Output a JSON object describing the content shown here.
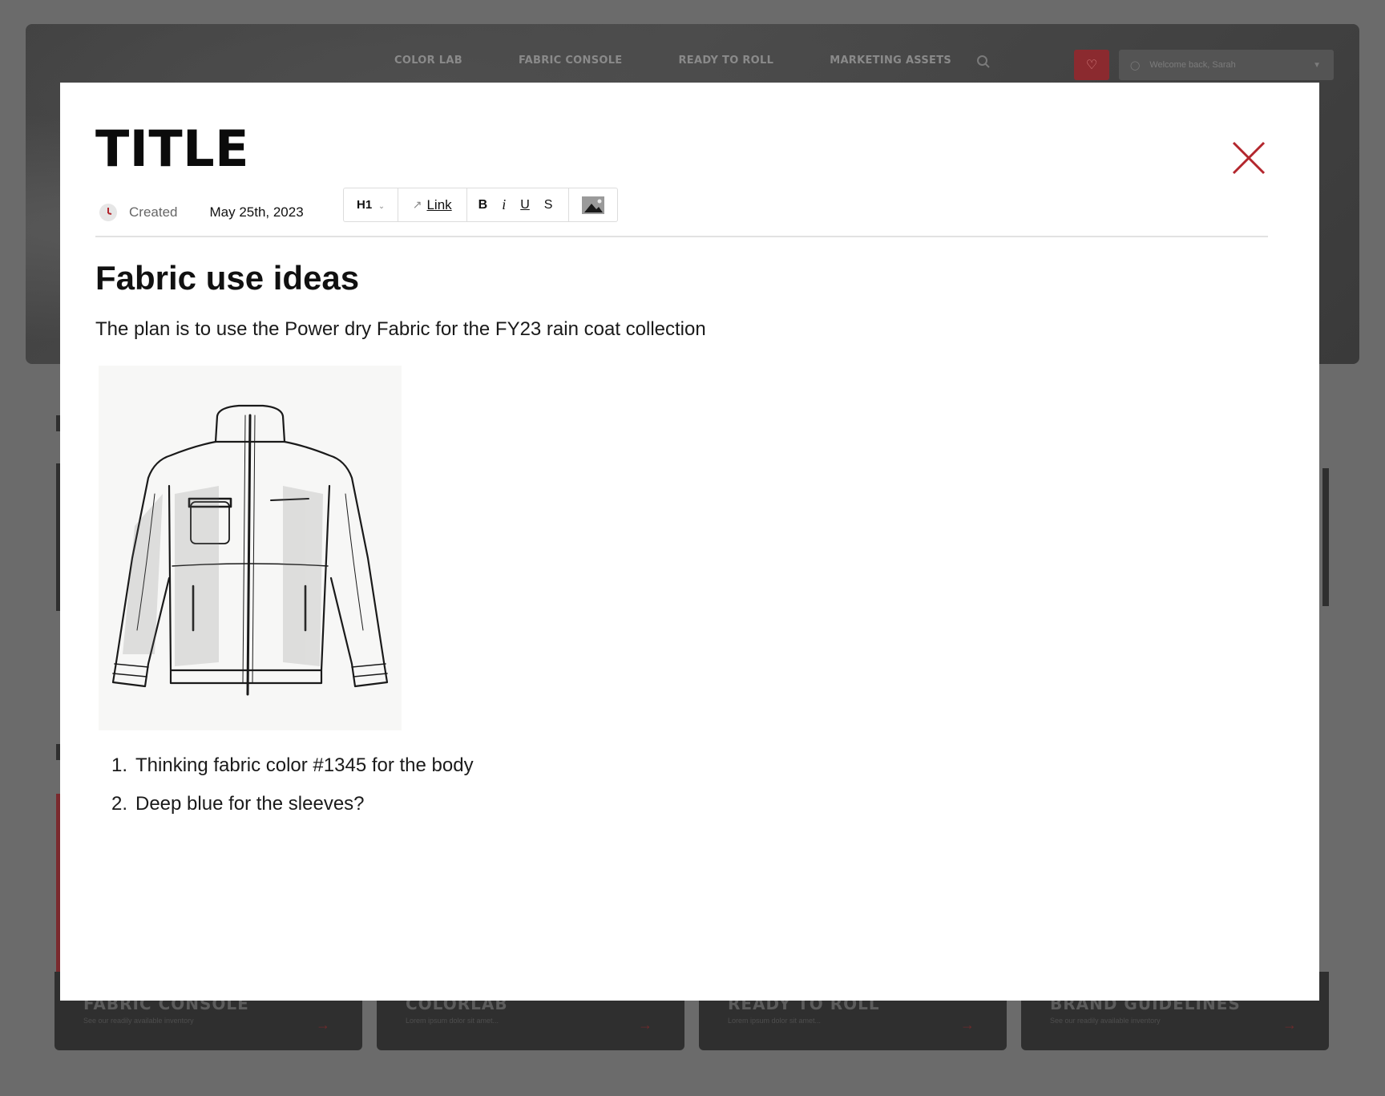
{
  "background": {
    "nav": [
      "COLOR LAB",
      "FABRIC CONSOLE",
      "READY TO ROLL",
      "MARKETING ASSETS"
    ],
    "user_greeting": "Welcome back, Sarah",
    "cards": [
      {
        "title": "FABRIC CONSOLE",
        "subtitle": "See our readily available inventory"
      },
      {
        "title": "COLORLAB",
        "subtitle": "Lorem ipsum dolor sit amet..."
      },
      {
        "title": "READY TO ROLL",
        "subtitle": "Lorem ipsum dolor sit amet..."
      },
      {
        "title": "BRAND GUIDELINES",
        "subtitle": "See our readily available inventory"
      }
    ],
    "colors": {
      "accent": "#8b2a2f"
    }
  },
  "modal": {
    "title": "TITLE",
    "created_label": "Created",
    "created_date": "May 25th, 2023",
    "toolbar": {
      "heading_select": "H1",
      "link_label": "Link",
      "bold": "B",
      "italic": "i",
      "underline": "U",
      "strike": "S"
    },
    "content": {
      "heading": "Fabric use ideas",
      "paragraph": "The plan is to use the Power dry Fabric for the FY23 rain coat collection",
      "list": [
        {
          "num": "1.",
          "text": "Thinking fabric color #1345 for the body"
        },
        {
          "num": "2.",
          "text": "Deep blue for the sleeves?"
        }
      ]
    },
    "colors": {
      "close": "#b3262d"
    }
  }
}
